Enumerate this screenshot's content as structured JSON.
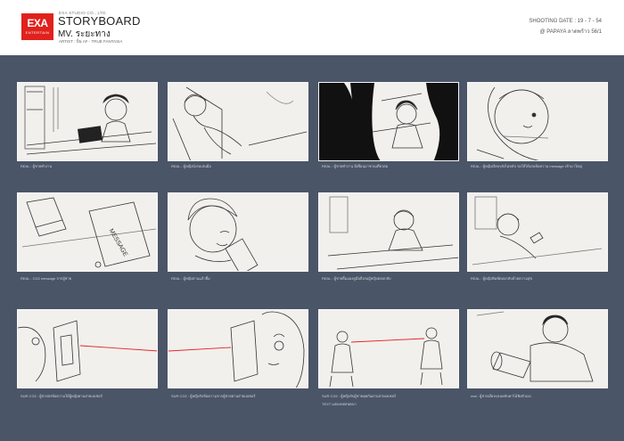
{
  "header": {
    "logo_main": "EXA",
    "logo_sub": "ENTERTAIN",
    "company": "EXA STUDIO CO., LTD.",
    "title": "STORYBOARD",
    "subtitle": "MV. ระยะทาง",
    "artist": "ARTIST : ปั้น AF - TRUE FANTASIA",
    "shooting_date": "SHOOTING DATE : 19 - 7 - 54",
    "location": "@ PAPAYA  ลาดพร้าว 56/1"
  },
  "colors": {
    "board": "#4b5568",
    "logo": "#e0211d",
    "laser": "#e8232a"
  },
  "panels": [
    {
      "caption": "REAL : ผู้ชายทำงาน"
    },
    {
      "caption": "REAL : ผู้หญิงนั่งรอเล่นมือ"
    },
    {
      "caption": "REAL : ผู้ชายทำงาน มีเพื่อนมาชวนเที่ยวต่อ"
    },
    {
      "caption": "REAL : ผู้หญิงเงียบๆยังไม่หลับ รอให้ได้เล่นข้อความ message เข้ามาใหญ่"
    },
    {
      "caption": "REAL : CG2 message จากผู้ชาย"
    },
    {
      "caption": "REAL : ผู้หญิงอ่านแล้วยิ้ม"
    },
    {
      "caption": "REAL : ผู้ชายยิ้มมองดูมือถือรอผู้หญิงตอบกลับ"
    },
    {
      "caption": "REAL : ผู้หญิงพิมพ์ตอบกลับด้วยความสุข"
    },
    {
      "caption": "SUR CG2 : ผู้ชายส่งข้อความให้ผู้หญิงผ่านสายเลเซอร์"
    },
    {
      "caption": "SUR CG2 : ผู้หญิงรับข้อความจากผู้ชายผ่านสายเลเซอร์"
    },
    {
      "caption": "SUR CG2 : ผู้หญิงกับผู้ชายคุยกันผ่านสายเลเซอร์",
      "caption2": "TEXT แสดงบทสนทนา"
    },
    {
      "caption": "real : ผู้ชายเงียบๆจนหลับคาไม้ฟังตัวเอง"
    }
  ]
}
